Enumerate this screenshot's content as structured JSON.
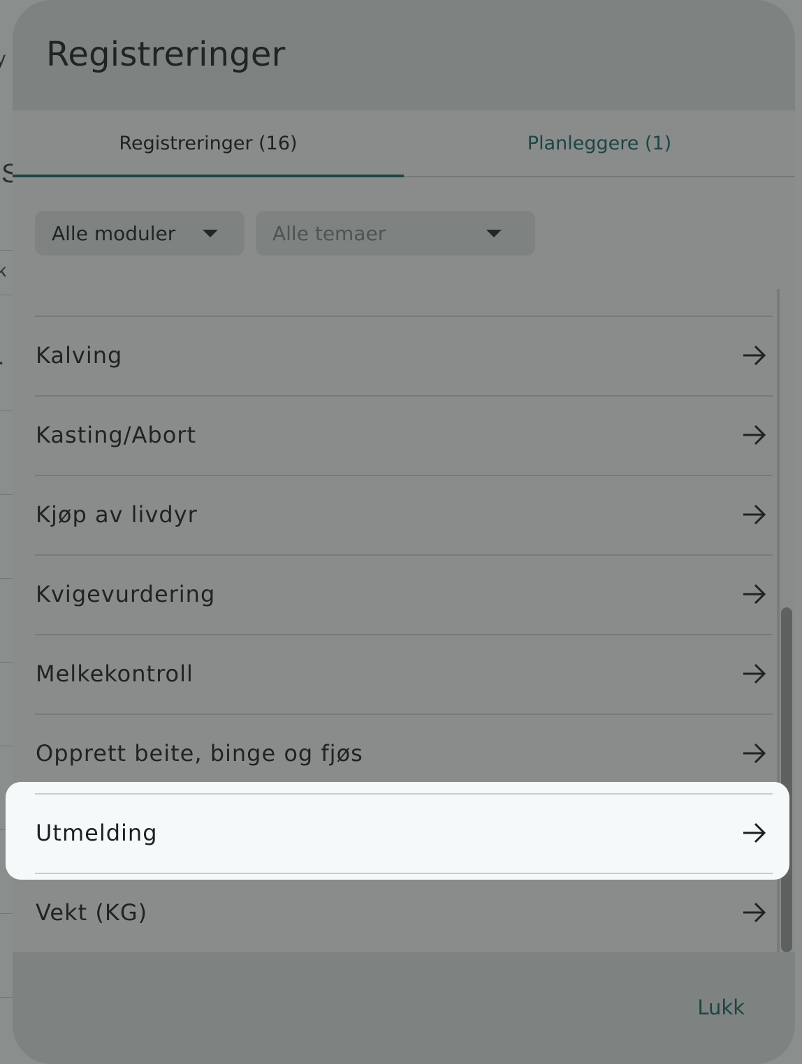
{
  "dialog": {
    "title": "Registreringer",
    "tabs": [
      {
        "label": "Registreringer (16)",
        "active": true
      },
      {
        "label": "Planleggere (1)",
        "active": false
      }
    ],
    "filters": {
      "modules": {
        "value": "Alle moduler"
      },
      "themes": {
        "placeholder": "Alle temaer"
      }
    },
    "items": [
      {
        "label": "Kalving"
      },
      {
        "label": "Kasting/Abort"
      },
      {
        "label": "Kjøp av livdyr"
      },
      {
        "label": "Kvigevurdering"
      },
      {
        "label": "Melkekontroll"
      },
      {
        "label": "Opprett beite, binge og fjøs"
      },
      {
        "label": "Utmelding",
        "highlighted": true
      },
      {
        "label": "Vekt (KG)"
      }
    ],
    "close_label": "Lukk"
  },
  "colors": {
    "accent": "#1f4645",
    "highlight_bg": "#f5f9f9",
    "overlay": "#7f8483"
  },
  "icons": {
    "row_arrow": "arrow-right-icon",
    "select_caret": "caret-down-icon"
  }
}
